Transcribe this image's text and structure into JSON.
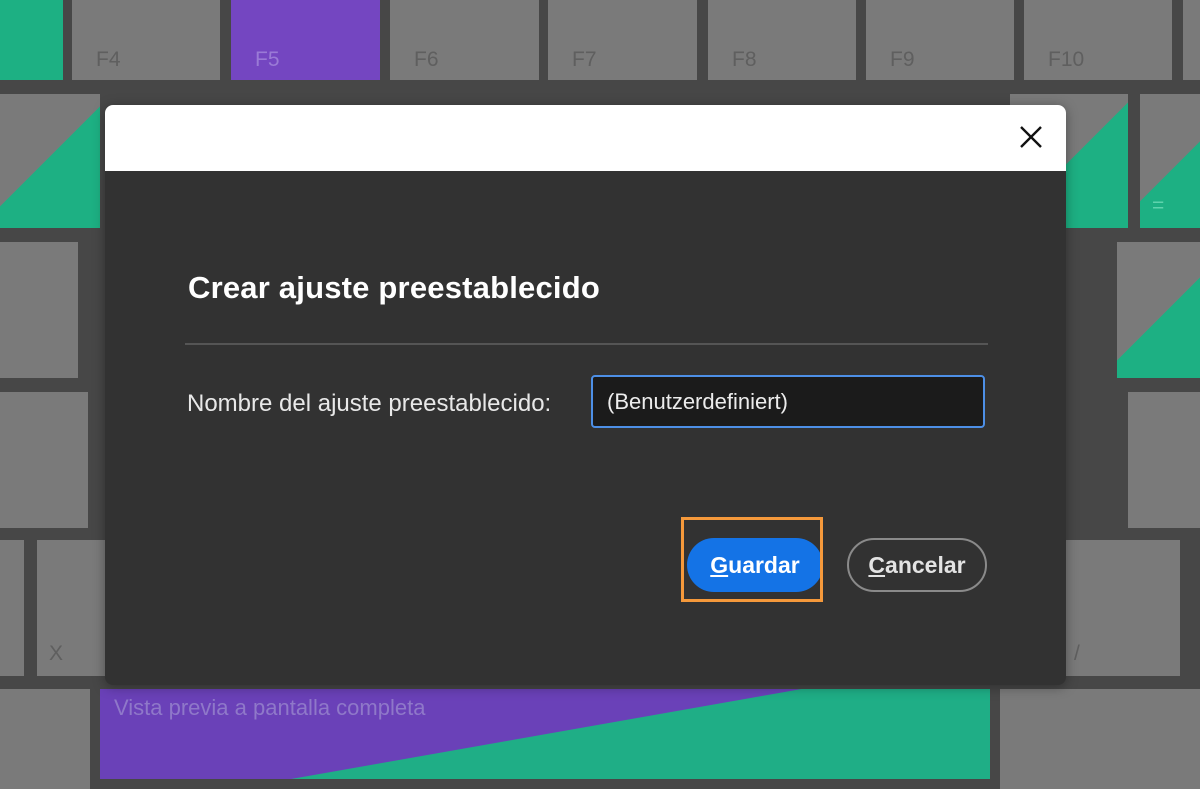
{
  "background": {
    "function_keys": [
      "F4",
      "F5",
      "F6",
      "F7",
      "F8",
      "F9",
      "F10"
    ],
    "other_keys": [
      "X",
      "/",
      "="
    ],
    "fullscreen_key_label": "Vista previa a pantalla completa",
    "colors": {
      "key_gray": "#7a7a7a",
      "purple": "#7446c1",
      "green": "#1db083"
    }
  },
  "dialog": {
    "title": "Crear ajuste preestablecido",
    "field_label": "Nombre del ajuste preestablecido:",
    "field_value": "(Benutzerdefiniert)",
    "save_button": {
      "mnemonic": "G",
      "rest": "uardar"
    },
    "cancel_button": {
      "mnemonic": "C",
      "rest": "ancelar"
    },
    "close_icon": "close-icon",
    "colors": {
      "primary": "#1473e6",
      "highlight": "#f5993b",
      "input_border": "#4d8fe6"
    }
  }
}
